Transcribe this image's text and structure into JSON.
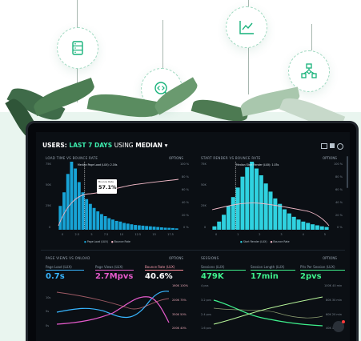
{
  "header": {
    "prefix": "USERS:",
    "range": "LAST 7 DAYS",
    "using": "USING",
    "median": "MEDIAN"
  },
  "panels": {
    "load_time": {
      "title": "LOAD TIME VS BOUNCE RATE",
      "options": "OPTIONS",
      "marker_label": "Median Page Load (LUX): 2.16s",
      "tooltip_title": "Bounce Rate",
      "tooltip_value": "57.1%",
      "legend": [
        "Page Load (LUX)",
        "Bounce Rate"
      ],
      "y_ticks": [
        "75K",
        "50K",
        "25K",
        "0"
      ],
      "y_right": [
        "100 %",
        "80 %",
        "60 %",
        "40 %",
        "20 %",
        "0 %"
      ],
      "x_ticks": [
        "0",
        "2.5",
        "5",
        "7.5",
        "10",
        "12.5",
        "15",
        "17.5"
      ]
    },
    "start_render": {
      "title": "START RENDER VS BOUNCE RATE",
      "options": "OPTIONS",
      "marker_label": "Median Start Render (LUX): 1.03s",
      "legend": [
        "Start Render (LUX)",
        "Bounce Rate"
      ],
      "y_ticks": [
        "75K",
        "50K",
        "25K",
        "0"
      ],
      "y_right": [
        "100 %",
        "80 %",
        "60 %",
        "40 %",
        "20 %",
        "0 %"
      ],
      "x_ticks": [
        "0",
        "1",
        "2",
        "3",
        "4",
        "5"
      ]
    },
    "page_views": {
      "title": "PAGE VIEWS VS ONLOAD",
      "options": "OPTIONS",
      "metrics": [
        {
          "label": "Page Load (LUX)",
          "value": "0.7s",
          "color": "#38b6ff"
        },
        {
          "label": "Page Views (LUX)",
          "value": "2.7Mpvs",
          "color": "#e55acb"
        },
        {
          "label": "Bounce Rate (LUX)",
          "value": "40.6%",
          "color": "#ff8c9a"
        }
      ],
      "y_left": [
        "10s",
        "5s",
        "0s"
      ],
      "y_right": [
        "160K 100%",
        "200K 75%",
        "350K 50%",
        "200K 40%"
      ]
    },
    "sessions": {
      "title": "SESSIONS",
      "options": "OPTIONS",
      "metrics": [
        {
          "label": "Sessions (LUX)",
          "value": "479K",
          "color": "#3ef08c"
        },
        {
          "label": "Session Length (LUX)",
          "value": "17min",
          "color": "#3ef08c"
        },
        {
          "label": "PVs Per Session (LUX)",
          "value": "2pvs",
          "color": "#3ef08c"
        }
      ],
      "y_left": [
        "4 pvs",
        "3.2 pvs",
        "2.4 pvs",
        "1.6 pvs"
      ],
      "y_right": [
        "100K 40 min",
        "80K 30 min",
        "60K 20 min",
        "40K 10 min"
      ]
    }
  },
  "colors": {
    "accent_green": "#00a86b",
    "bars_blue": "#17a3d6",
    "bars_teal": "#2fd2e0",
    "pink": "#f0b8c6"
  }
}
